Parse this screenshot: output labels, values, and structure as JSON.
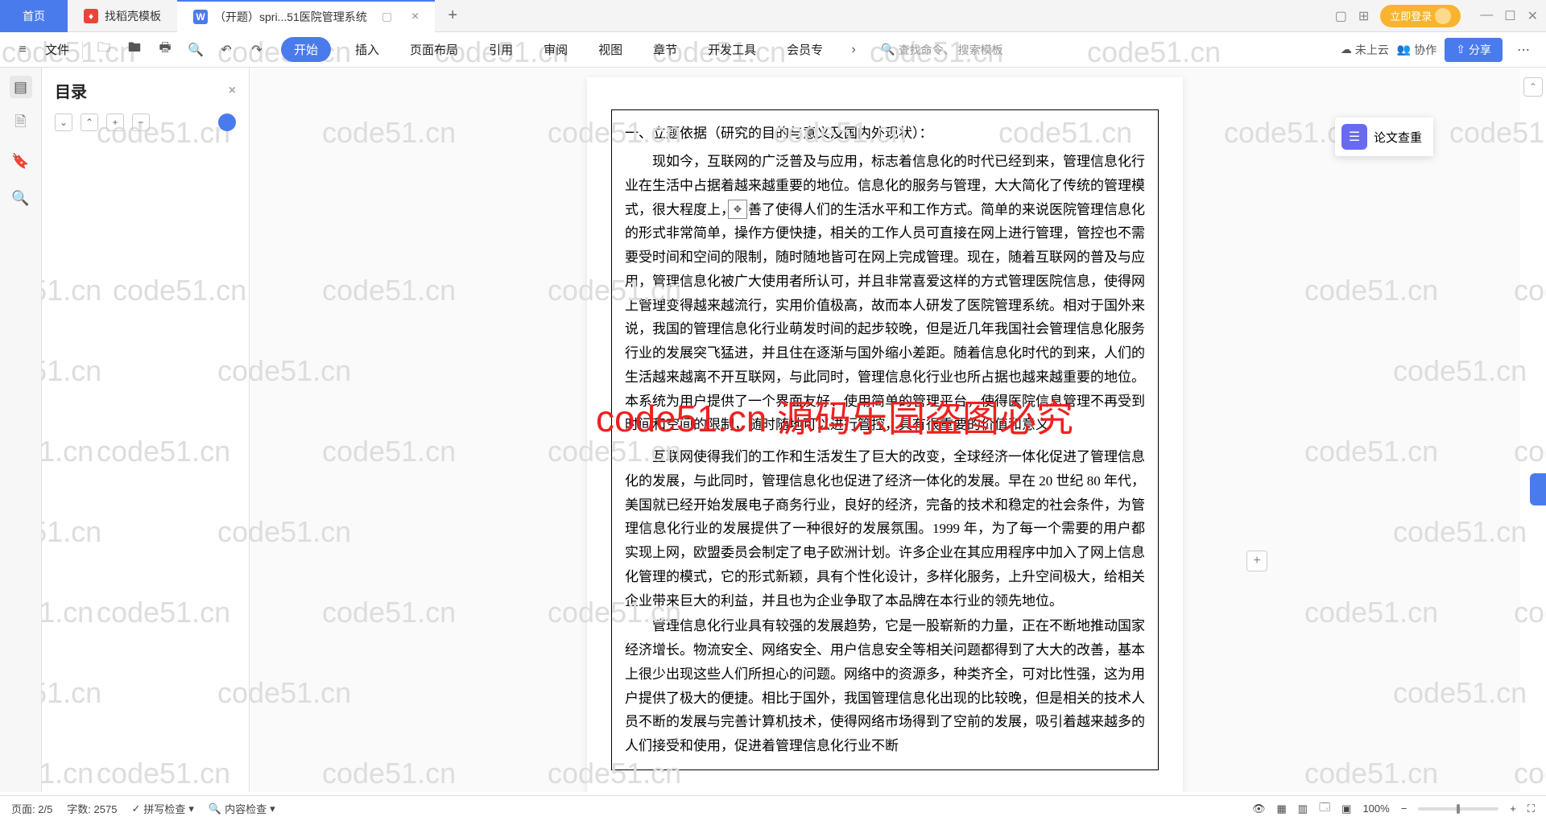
{
  "tabs": {
    "home": "首页",
    "tab1": "找稻壳模板",
    "tab2": "（开题）spri...51医院管理系统",
    "w_letter": "W",
    "login": "立即登录"
  },
  "toolbar": {
    "file": "文件",
    "start": "开始",
    "menu": [
      "插入",
      "页面布局",
      "引用",
      "审阅",
      "视图",
      "章节",
      "开发工具",
      "会员专"
    ],
    "search_cmd": "查找命令、",
    "search_tpl": "搜索模板",
    "cloud": "未上云",
    "collab": "协作",
    "share": "分享"
  },
  "outline": {
    "title": "目录"
  },
  "rightpanel": {
    "plagiarism": "论文查重"
  },
  "document": {
    "heading": "一、立题依据（研究的目的与意义及国内外现状）：",
    "p1": "现如今，互联网的广泛普及与应用，标志着信息化的时代已经到来，管理信息化行业在生活中占据着越来越重要的地位。信息化的服务与管理，大大简化了传统的管理模式，很大程度上，改善了使得人们的生活水平和工作方式。简单的来说医院管理信息化的形式非常简单，操作方便快捷，相关的工作人员可直接在网上进行管理，管控也不需要受时间和空间的限制，随时随地皆可在网上完成管理。现在，随着互联网的普及与应用，管理信息化被广大使用者所认可，并且非常喜爱这样的方式管理医院信息，使得网上管理变得越来越流行，实用价值极高，故而本人研发了医院管理系统。相对于国外来说，我国的管理信息化行业萌发时间的起步较晚，但是近几年我国社会管理信息化服务行业的发展突飞猛进，并且住在逐渐与国外缩小差距。随着信息化时代的到来，人们的生活越来越离不开互联网，与此同时，管理信息化行业也所占据也越来越重要的地位。本系统为用户提供了一个界面友好、使用简单的管理平台，使得医院信息管理不再受到时间和空间的限制，随时随地可以进行管控，具有很重要的价值和意义",
    "p2": "互联网使得我们的工作和生活发生了巨大的改变，全球经济一体化促进了管理信息化的发展，与此同时，管理信息化也促进了经济一体化的发展。早在 20 世纪 80 年代，美国就已经开始发展电子商务行业，良好的经济，完备的技术和稳定的社会条件，为管理信息化行业的发展提供了一种很好的发展氛围。1999 年，为了每一个需要的用户都实现上网，欧盟委员会制定了电子欧洲计划。许多企业在其应用程序中加入了网上信息化管理的模式，它的形式新颖，具有个性化设计，多样化服务，上升空间极大，给相关企业带来巨大的利益，并且也为企业争取了本品牌在本行业的领先地位。",
    "p3": "管理信息化行业具有较强的发展趋势，它是一股崭新的力量，正在不断地推动国家经济增长。物流安全、网络安全、用户信息安全等相关问题都得到了大大的改善，基本上很少出现这些人们所担心的问题。网络中的资源多，种类齐全，可对比性强，这为用户提供了极大的便捷。相比于国外，我国管理信息化出现的比较晚，但是相关的技术人员不断的发展与完善计算机技术，使得网络市场得到了空前的发展，吸引着越来越多的人们接受和使用，促进着管理信息化行业不断"
  },
  "overlay": "code51.cn 源码乐园盗图必究",
  "watermark": "code51.cn",
  "status": {
    "page": "页面: 2/5",
    "words": "字数: 2575",
    "spell": "拼写检查",
    "content": "内容检查",
    "zoom": "100%"
  }
}
